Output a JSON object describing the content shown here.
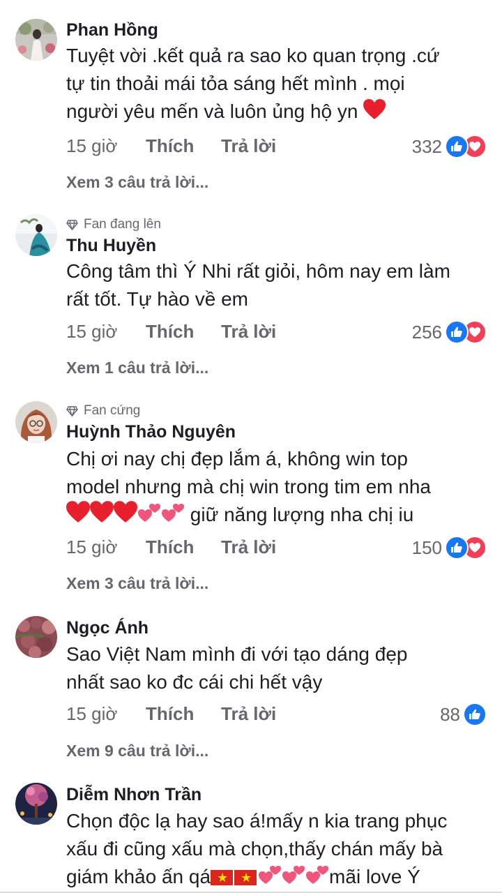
{
  "comments": [
    {
      "author": "Phan Hồng",
      "badge": "",
      "text_lines": [
        "Tuyệt vời .kết quả ra sao ko quan trọng .cứ",
        "tự tin thoải mái tỏa sáng hết mình . mọi",
        "người yêu mến và luôn ủng hộ yn"
      ],
      "time": "15 giờ",
      "like_label": "Thích",
      "reply_label": "Trả lời",
      "reaction_count": "332",
      "reactions": [
        "like-icon",
        "love-icon"
      ],
      "view_replies": "Xem 3 câu trả lời..."
    },
    {
      "author": "Thu Huyền",
      "badge": "Fan đang lên",
      "text_lines": [
        "Công tâm thì Ý Nhi rất giỏi, hôm nay em làm",
        "rất tốt. Tự hào về em"
      ],
      "time": "15 giờ",
      "like_label": "Thích",
      "reply_label": "Trả lời",
      "reaction_count": "256",
      "reactions": [
        "like-icon",
        "love-icon"
      ],
      "view_replies": "Xem 1 câu trả lời..."
    },
    {
      "author": "Huỳnh Thảo Nguyên",
      "badge": "Fan cứng",
      "text_lines": [
        "Chị ơi nay chị đẹp lắm á, không win top",
        "model nhưng mà chị win trong tim em nha",
        "giữ năng lượng nha chị iu"
      ],
      "time": "15 giờ",
      "like_label": "Thích",
      "reply_label": "Trả lời",
      "reaction_count": "150",
      "reactions": [
        "like-icon",
        "love-icon"
      ],
      "view_replies": "Xem 3 câu trả lời..."
    },
    {
      "author": "Ngọc Ánh",
      "badge": "",
      "text_lines": [
        "Sao Việt Nam mình đi với tạo dáng đẹp",
        "nhất sao ko đc cái chi hết vậy"
      ],
      "time": "15 giờ",
      "like_label": "Thích",
      "reply_label": "Trả lời",
      "reaction_count": "88",
      "reactions": [
        "like-icon"
      ],
      "view_replies": "Xem 9 câu trả lời..."
    },
    {
      "author": "Diễm Nhơn Trần",
      "badge": "",
      "text_lines": [
        "Chọn độc lạ hay sao á!mấy n kia trang phục",
        "xấu đi cũng xấu mà chọn,thấy chán mấy bà",
        "giám khảo ấn qá",
        "mãi love Ý"
      ]
    }
  ],
  "colors": {
    "like": "#1877f2",
    "love": "#f33e58",
    "muted": "#65676b",
    "text": "#1c1e21"
  }
}
